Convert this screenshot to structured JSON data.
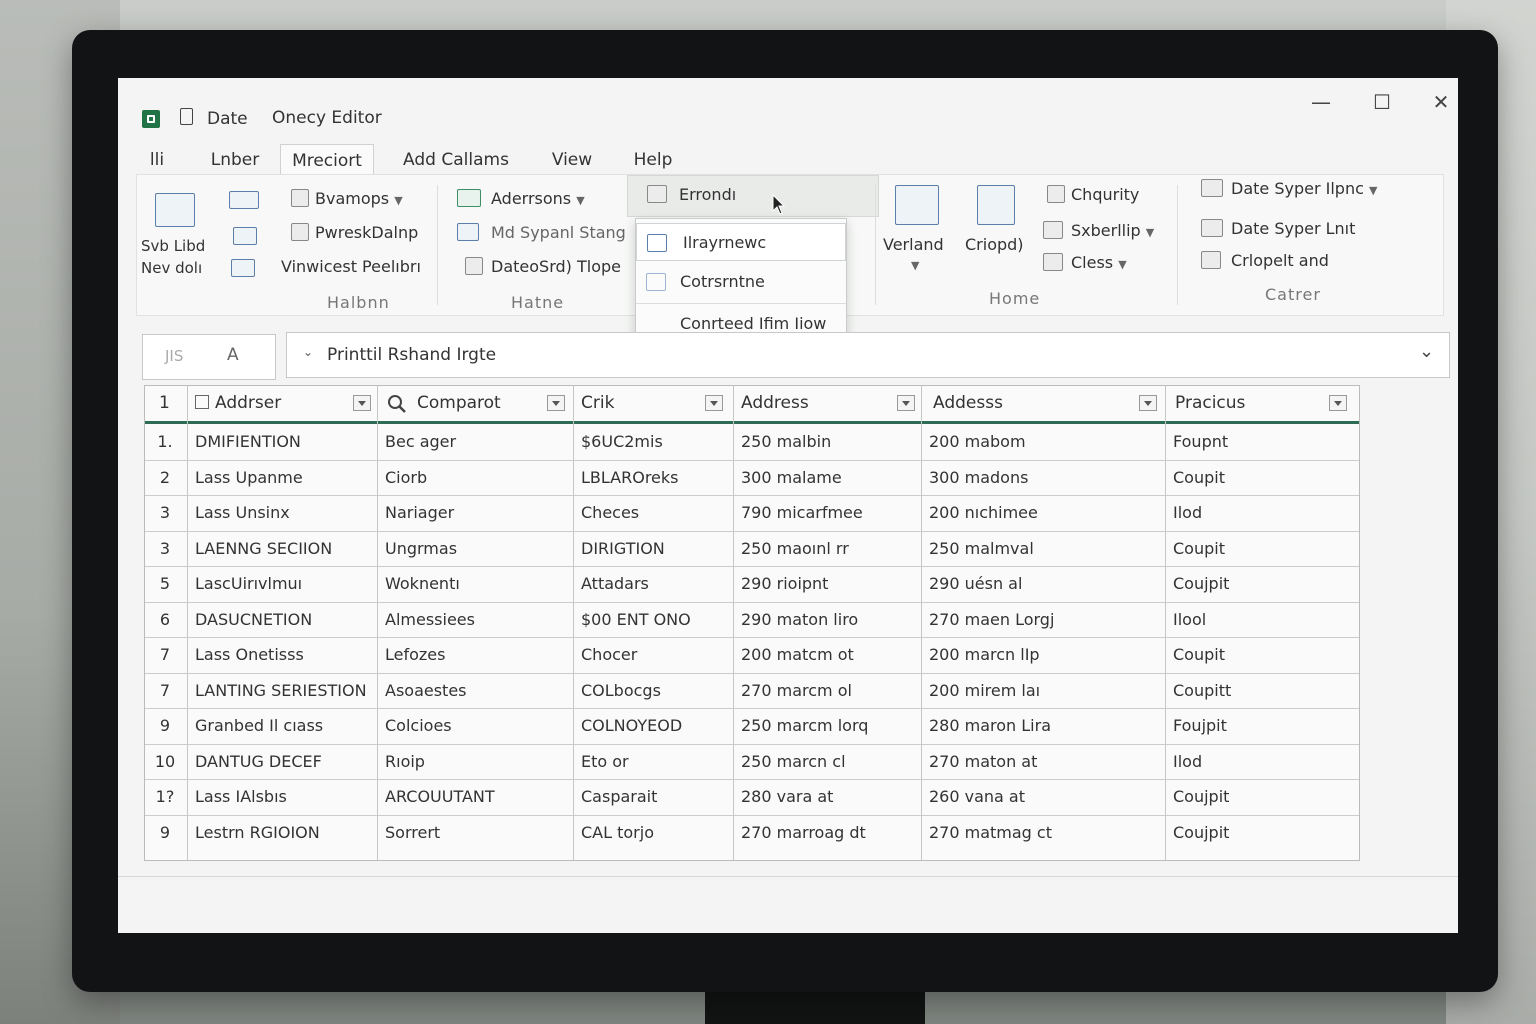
{
  "window": {
    "doc_label": "Date",
    "title": "Onecy Editor",
    "minimize": "—",
    "maximize": "☐",
    "close": "✕"
  },
  "tabs": [
    "lli",
    "Lnber",
    "Mreciort",
    "Add Callams",
    "View",
    "Help"
  ],
  "ribbon": {
    "group1": {
      "label": "Halbnn",
      "big_label_1": "Svb Libd",
      "big_label_2": "Nev dolı",
      "item1": "Bvamops",
      "item2": "PwreskDalnp",
      "item3": "Vinwicest Peelıbrı"
    },
    "group2": {
      "label": "Hatne",
      "item1": "Aderrsons",
      "item2": "Md Sypanl Stang",
      "item3": "DateoSrd) Tlope"
    },
    "group3": {
      "item1": "Errondı"
    },
    "group4": {
      "label": "Home",
      "big1": "Verland",
      "big2": "Criopd)",
      "item1": "Chqurity",
      "item2": "Sxberllip",
      "item3": "Cless"
    },
    "group5": {
      "label": "Catrer",
      "item1": "Date Syper Ilpnc",
      "item2": "Date Syper Lnıt",
      "item3": "Crlopelt and"
    }
  },
  "menu": {
    "items": [
      "Ilrayrnewc",
      "Cotrsrntne",
      "Conrteed Ifim Iiow"
    ]
  },
  "namebox": {
    "left": "JIS",
    "right": "A"
  },
  "formula": {
    "text": "Printtil Rshand Irgte"
  },
  "colors": {
    "accent_green": "#217346",
    "header_rule": "#2d6b55",
    "icon_blue": "#5b7fa8"
  },
  "table": {
    "corner": "1",
    "headers": [
      "Addrser",
      "Comparot",
      "Crik",
      "Address",
      "Addesss",
      "Pracicus"
    ],
    "rows": [
      [
        "1.",
        "DMIFIENTION",
        "Bec ager",
        "$6UC2mis",
        "250 malbin",
        "200 mabom",
        "Foupnt"
      ],
      [
        "2",
        "Lass Upanme",
        "Ciorb",
        "LBLAROreks",
        "300 malame",
        "300 madons",
        "Coupit"
      ],
      [
        "3",
        "Lass Unsinx",
        "Nariager",
        "Checes",
        "790 micarfmee",
        "200 nıchimee",
        "Ilod"
      ],
      [
        "3",
        "LAENNG SECIION",
        "Ungrmas",
        "DIRIGTION",
        "250 maoınl rr",
        "250 malmval",
        "Coupit"
      ],
      [
        "5",
        "LascUirıvlmuı",
        "Woknentı",
        "Attadars",
        "290 rioipnt",
        "290 uésn al",
        "Coujpit"
      ],
      [
        "6",
        "DASUCNETION",
        "Almessiees",
        "$00 ENT ONO",
        "290 maton liro",
        "270 maen Lorgj",
        "Ilool"
      ],
      [
        "7",
        "Lass Onetisss",
        "Lefozes",
        "Chocer",
        "200 matcm ot",
        "200 marcn lIp",
        "Coupit"
      ],
      [
        "7",
        "LANTING SERIESTION",
        "Asoaestes",
        "COLbocgs",
        "270 marcm ol",
        "200 mirem laı",
        "Coupitt"
      ],
      [
        "9",
        "Granbed Il cıass",
        "Colcioes",
        "COLNOYEOD",
        "250 marcm lorq",
        "280 maron Lira",
        "Foujpit"
      ],
      [
        "10",
        "DANTUG DECEF",
        "Rıoip",
        "Eto or",
        "250 marcn cl",
        "270 maton at",
        "Ilod"
      ],
      [
        "1?",
        "Lass IAlsbıs",
        "ARCOUUTANT",
        "Casparait",
        "280 vara at",
        "260 vana at",
        "Coujpit"
      ],
      [
        "9",
        "Lestrn RGIOION",
        "Sorrert",
        "CAL torjo",
        "270 marroag dt",
        "270 matmag ct",
        "Coujpit"
      ]
    ]
  }
}
